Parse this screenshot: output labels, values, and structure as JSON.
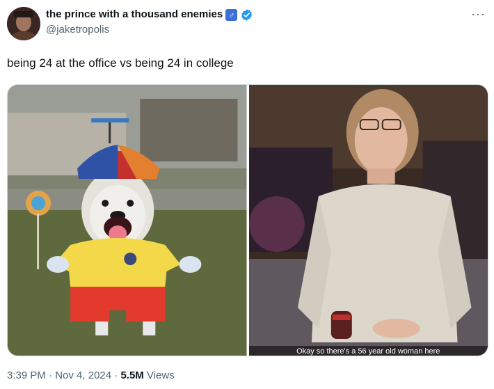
{
  "author": {
    "display_name": "the prince with a thousand enemies",
    "gender_emoji": "♂",
    "handle": "@jaketropolis",
    "verified": true
  },
  "more_icon": "···",
  "tweet": {
    "text": "being 24 at the office vs being 24 in college"
  },
  "media": {
    "right_caption": "Okay so there's a 56 year old woman here"
  },
  "meta": {
    "time": "3:39 PM",
    "separator": "·",
    "date": "Nov 4, 2024",
    "views_count": "5.5M",
    "views_label": "Views"
  },
  "colors": {
    "verified": "#1d9bf0",
    "secondary_text": "#536471",
    "primary_text": "#0f1419"
  }
}
